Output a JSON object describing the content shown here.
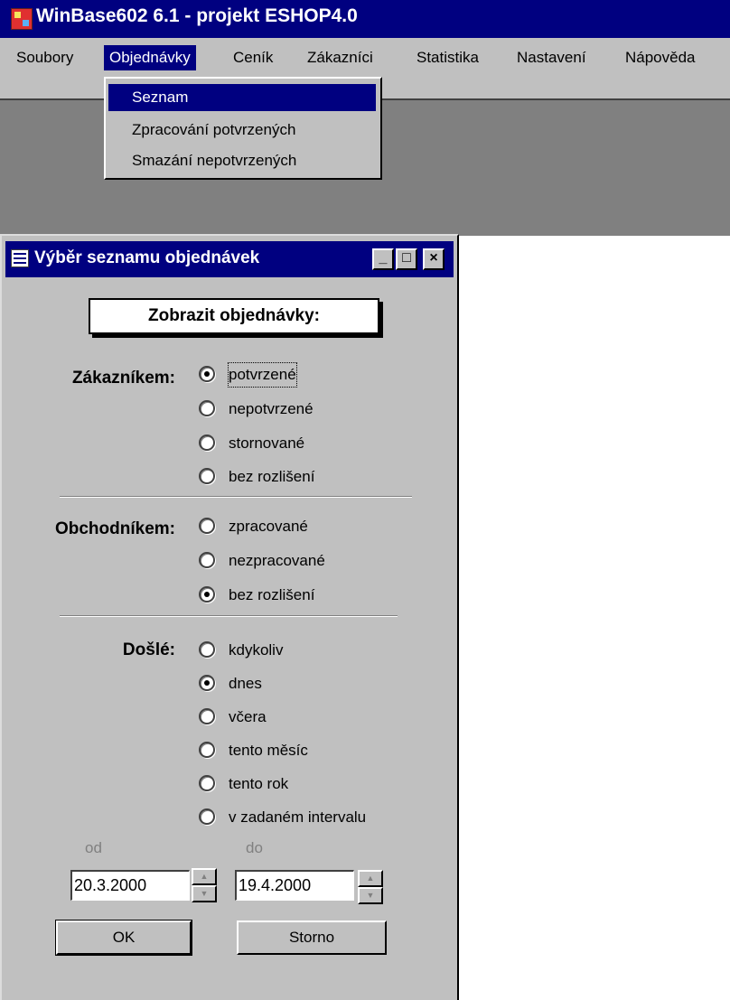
{
  "app": {
    "title": "WinBase602 6.1 - projekt ESHOP4.0"
  },
  "menubar": {
    "items": [
      {
        "label": "Soubory"
      },
      {
        "label": "Objednávky"
      },
      {
        "label": "Ceník"
      },
      {
        "label": "Zákazníci"
      },
      {
        "label": "Statistika"
      },
      {
        "label": "Nastavení"
      },
      {
        "label": "Nápověda"
      }
    ],
    "active_index": 1
  },
  "dropdown": {
    "items": [
      {
        "label": "Seznam",
        "selected": true
      },
      {
        "label": "Zpracování potvrzených",
        "selected": false
      },
      {
        "label": "Smazání nepotvrzených",
        "selected": false
      }
    ]
  },
  "dialog": {
    "title": "Výběr seznamu objednávek",
    "caption_buttons": {
      "minimize": "_",
      "maximize": "□",
      "close": "×"
    },
    "heading": "Zobrazit objednávky:",
    "groups": {
      "zakaznikem": {
        "label": "Zákazníkem:",
        "options": [
          {
            "label": "potvrzené",
            "checked": true
          },
          {
            "label": "nepotvrzené",
            "checked": false
          },
          {
            "label": "stornované",
            "checked": false
          },
          {
            "label": "bez rozlišení",
            "checked": false
          }
        ]
      },
      "obchodnikem": {
        "label": "Obchodníkem:",
        "options": [
          {
            "label": "zpracované",
            "checked": false
          },
          {
            "label": "nezpracované",
            "checked": false
          },
          {
            "label": "bez rozlišení",
            "checked": true
          }
        ]
      },
      "dosle": {
        "label": "Došlé:",
        "options": [
          {
            "label": "kdykoliv",
            "checked": false
          },
          {
            "label": "dnes",
            "checked": true
          },
          {
            "label": "včera",
            "checked": false
          },
          {
            "label": "tento měsíc",
            "checked": false
          },
          {
            "label": "tento rok",
            "checked": false
          },
          {
            "label": "v zadaném intervalu",
            "checked": false
          }
        ]
      }
    },
    "date_from": {
      "label": "od",
      "value": "20.3.2000"
    },
    "date_to": {
      "label": "do",
      "value": "19.4.2000"
    },
    "ok_button": "OK",
    "cancel_button": "Storno"
  }
}
